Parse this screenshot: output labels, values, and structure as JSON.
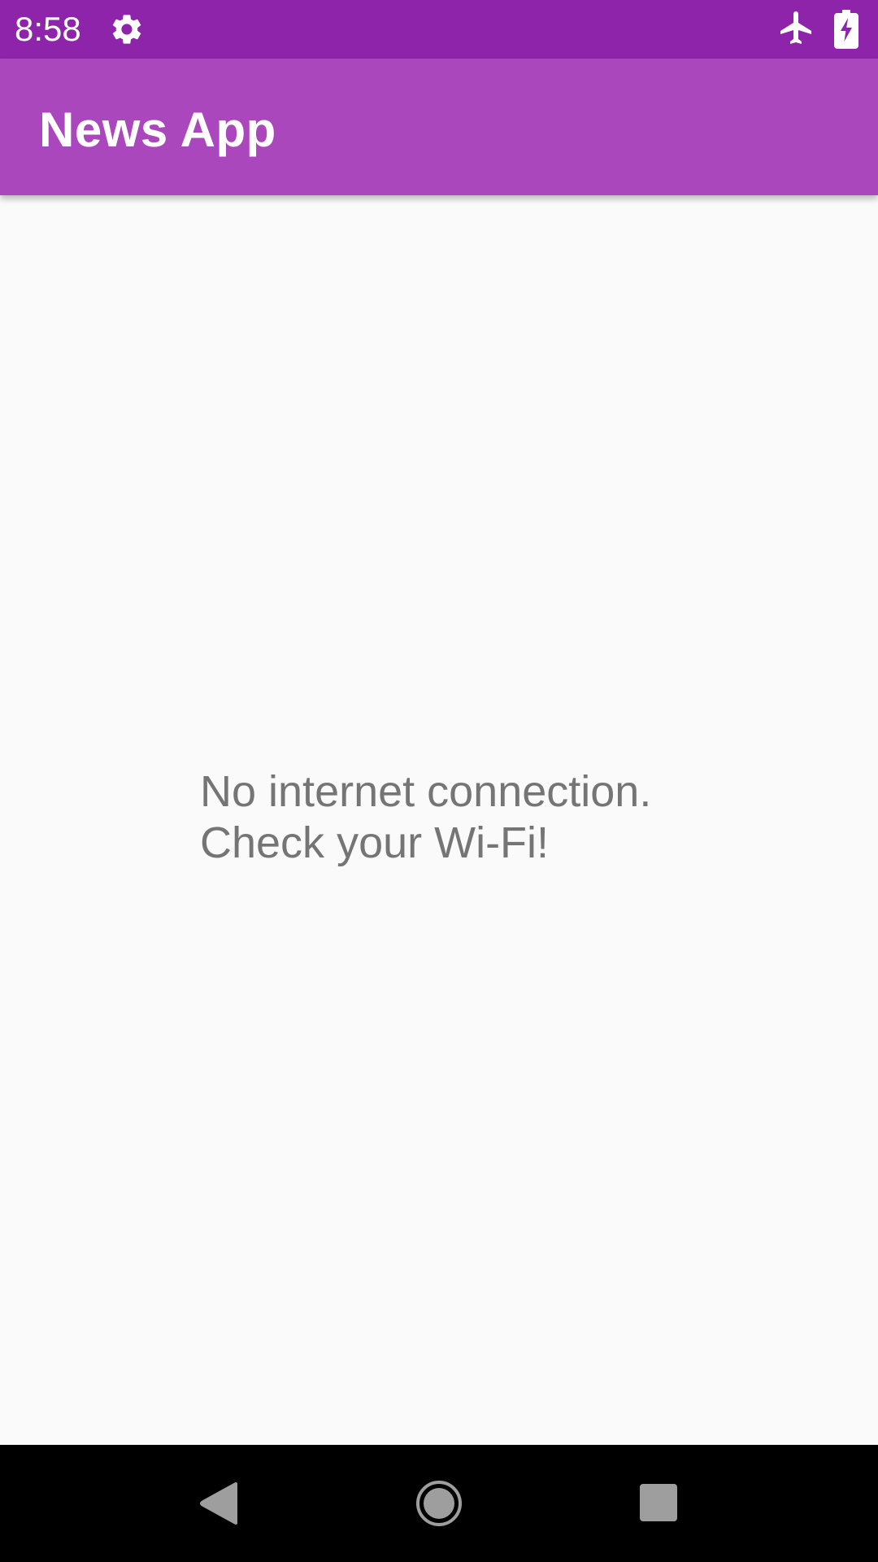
{
  "status_bar": {
    "time": "8:58",
    "icons": [
      "gear-icon",
      "airplane-mode-icon",
      "battery-charging-icon"
    ],
    "color": "#8e24aa"
  },
  "app_bar": {
    "title": "News App",
    "color": "#ab47bc"
  },
  "content": {
    "message_line1": "No internet connection.",
    "message_line2": "Check your Wi-Fi!",
    "text_color": "#757575",
    "background": "#fafafa"
  },
  "nav_bar": {
    "buttons": [
      "back-icon",
      "home-icon",
      "recents-icon"
    ],
    "icon_color": "#9e9e9e"
  }
}
